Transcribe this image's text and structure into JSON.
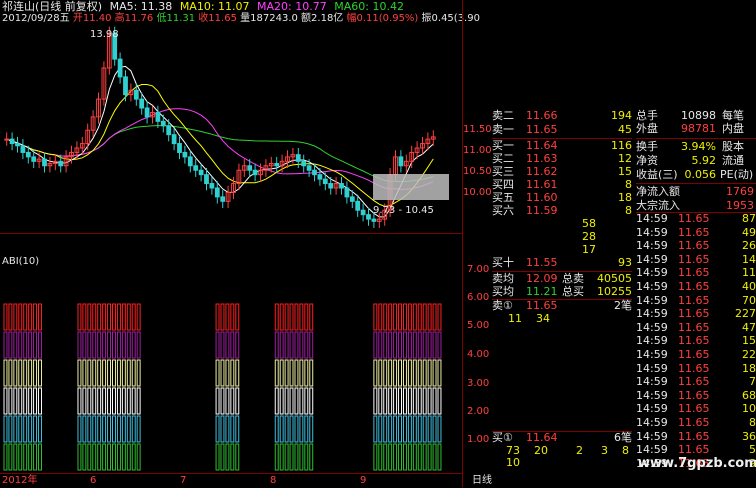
{
  "header": {
    "title": "祁连山(日线 前复权)",
    "ma": [
      {
        "label": "MA5: 11.38",
        "color": "#ffffff"
      },
      {
        "label": "MA10: 11.07",
        "color": "#ffff00"
      },
      {
        "label": "MA20: 10.77",
        "color": "#ff40ff"
      },
      {
        "label": "MA60: 10.42",
        "color": "#30d030"
      }
    ],
    "quote": [
      {
        "label": "2012/09/28五",
        "color": "#e8e8e8"
      },
      {
        "label": "开11.40",
        "color": "#ff4040"
      },
      {
        "label": "高11.76",
        "color": "#ff4040"
      },
      {
        "label": "低11.31",
        "color": "#30d030"
      },
      {
        "label": "收11.65",
        "color": "#ff4040"
      },
      {
        "label": "量187243.0",
        "color": "#e8e8e8"
      },
      {
        "label": "额2.18亿",
        "color": "#e8e8e8"
      },
      {
        "label": "幅0.11(0.95%)",
        "color": "#ff4040"
      },
      {
        "label": "振0.45(3.90",
        "color": "#e8e8e8"
      }
    ]
  },
  "chart": {
    "high_label": "13.98",
    "low_label": "9.73 - 10.45",
    "y_ticks": [
      "11.50",
      "11.00",
      "10.50",
      "10.00"
    ],
    "indicator_title": "ABI(10)",
    "indicator_ticks": [
      "7.00",
      "6.00",
      "5.00",
      "4.00",
      "3.00",
      "2.00",
      "1.00"
    ],
    "x_labels": [
      "2012年",
      "6",
      "7",
      "8",
      "9"
    ],
    "period": "日线",
    "watermark": "www.7gpzb.com"
  },
  "order_book": {
    "sells": [
      {
        "label": "卖二",
        "price": "11.66",
        "vol": "194"
      },
      {
        "label": "卖一",
        "price": "11.65",
        "vol": "45"
      }
    ],
    "buys": [
      {
        "label": "买一",
        "price": "11.64",
        "vol": "116"
      },
      {
        "label": "买二",
        "price": "11.63",
        "vol": "12"
      },
      {
        "label": "买三",
        "price": "11.62",
        "vol": "15"
      },
      {
        "label": "买四",
        "price": "11.61",
        "vol": "8"
      },
      {
        "label": "买五",
        "price": "11.60",
        "vol": "18"
      },
      {
        "label": "买六",
        "price": "11.59",
        "vol": "8"
      },
      {
        "label": "",
        "price": "58",
        "vol": ""
      },
      {
        "label": "",
        "price": "28",
        "vol": ""
      },
      {
        "label": "",
        "price": "17",
        "vol": ""
      },
      {
        "label": "买十",
        "price": "11.55",
        "vol": "93"
      }
    ],
    "avg_sell": {
      "label": "卖均",
      "price": "12.09",
      "total_label": "总卖",
      "total": "40505"
    },
    "avg_buy": {
      "label": "买均",
      "price": "11.21",
      "total_label": "总买",
      "total": "10255"
    },
    "sell_one_bar": {
      "label": "卖①",
      "price": "11.65",
      "count": "2笔",
      "q1": "11",
      "q2": "34"
    },
    "buy_one_bar": {
      "label": "买①",
      "price": "11.64",
      "count": "6笔",
      "nums": [
        "73",
        "20",
        "2",
        "3",
        "8"
      ],
      "extra": "10"
    }
  },
  "stats": {
    "rows": [
      {
        "a": "总手",
        "av": "10898",
        "b": "每笔"
      },
      {
        "a": "外盘",
        "av": "98781",
        "b": "内盘"
      },
      {
        "a": "换手",
        "av": "3.94%",
        "b": "股本"
      },
      {
        "a": "净资",
        "av": "5.92",
        "b": "流通"
      },
      {
        "a": "收益(三)",
        "av": "0.056",
        "b": "PE(动)"
      }
    ],
    "net_inflow": {
      "label": "净流入额",
      "value": "1769"
    },
    "block_inflow": {
      "label": "大宗流入",
      "value": "1953"
    }
  },
  "ticks": {
    "rows": [
      {
        "t": "14:59",
        "p": "11.65",
        "v": "87"
      },
      {
        "t": "14:59",
        "p": "11.65",
        "v": "49"
      },
      {
        "t": "14:59",
        "p": "11.65",
        "v": "26"
      },
      {
        "t": "14:59",
        "p": "11.65",
        "v": "14"
      },
      {
        "t": "14:59",
        "p": "11.65",
        "v": "11"
      },
      {
        "t": "14:59",
        "p": "11.65",
        "v": "40"
      },
      {
        "t": "14:59",
        "p": "11.65",
        "v": "70"
      },
      {
        "t": "14:59",
        "p": "11.65",
        "v": "227"
      },
      {
        "t": "14:59",
        "p": "11.65",
        "v": "47"
      },
      {
        "t": "14:59",
        "p": "11.65",
        "v": "15"
      },
      {
        "t": "14:59",
        "p": "11.65",
        "v": "22"
      },
      {
        "t": "14:59",
        "p": "11.65",
        "v": "18"
      },
      {
        "t": "14:59",
        "p": "11.65",
        "v": "7"
      },
      {
        "t": "14:59",
        "p": "11.65",
        "v": "68"
      },
      {
        "t": "14:59",
        "p": "11.65",
        "v": "10"
      },
      {
        "t": "14:59",
        "p": "11.65",
        "v": "8"
      },
      {
        "t": "14:59",
        "p": "11.65",
        "v": "36"
      },
      {
        "t": "14:59",
        "p": "11.65",
        "v": "5"
      },
      {
        "t": "14:59",
        "p": "11.65",
        "v": "9"
      }
    ]
  },
  "colors": {
    "up": "#ff4040",
    "down": "#30d0d0",
    "ma5": "#ffffff",
    "ma10": "#ffff00",
    "ma20": "#ff40ff",
    "ma60": "#30d030",
    "grid": "#800000"
  }
}
